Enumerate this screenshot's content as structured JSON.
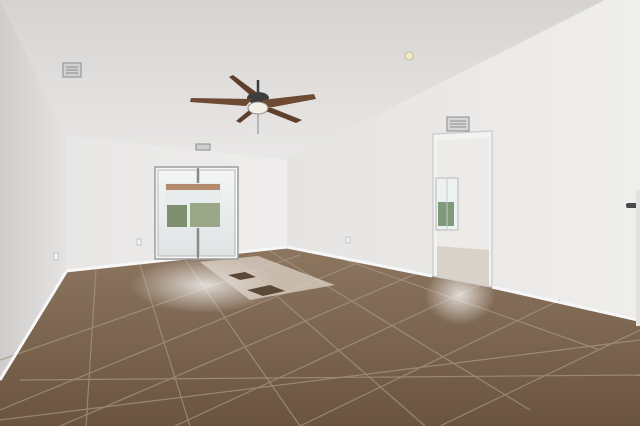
{
  "scene": {
    "kind": "empty-living-room-photo",
    "colors": {
      "wall_light": "#ecebea",
      "wall_shadow": "#d8d6d4",
      "ceiling": "#e3e2e1",
      "floor_tile": "#7a624b",
      "floor_tile_dark": "#5c4836",
      "grout": "#a99580",
      "baseboard": "#f6f6f6",
      "fan_blade": "#6e4a33",
      "fan_motor": "#3d3d3f"
    },
    "icons": [
      "ceiling-fan-icon",
      "air-vent-icon",
      "sliding-glass-door-icon",
      "doorway-icon",
      "window-icon",
      "smoke-detector-icon",
      "electrical-outlet-icon",
      "door-handle-icon"
    ]
  }
}
